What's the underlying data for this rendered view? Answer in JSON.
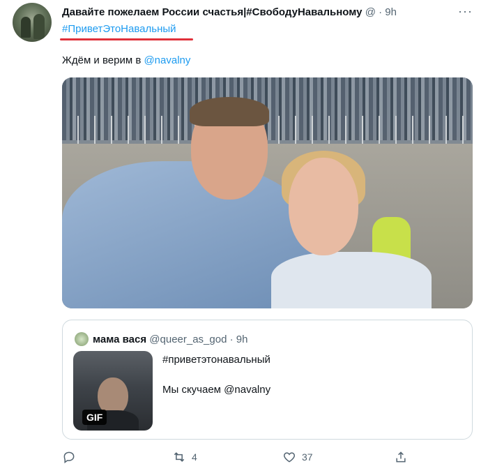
{
  "tweet": {
    "author_name": "Давайте пожелаем России счастья|#СвободуНавальному",
    "author_handle": "@",
    "separator": "·",
    "time": "9h",
    "more_icon": "more-horizontal-icon",
    "hashtag": "#ПриветЭтоНавальный",
    "text_prefix": "Ждём и верим в ",
    "mention": "@navalny",
    "underline_color": "#e0303a"
  },
  "quoted": {
    "author_name": "мама вася",
    "author_handle": "@queer_as_god",
    "separator": "·",
    "time": "9h",
    "media_badge": "GIF",
    "line1": "#приветэтонавальный",
    "line2": "Мы скучаем @navalny"
  },
  "actions": {
    "reply_icon": "reply-icon",
    "retweet_icon": "retweet-icon",
    "retweet_count": "4",
    "like_icon": "heart-icon",
    "like_count": "37",
    "share_icon": "share-icon"
  },
  "colors": {
    "link": "#1d9bf0",
    "secondary_text": "#536471",
    "border": "#cfd9de"
  }
}
